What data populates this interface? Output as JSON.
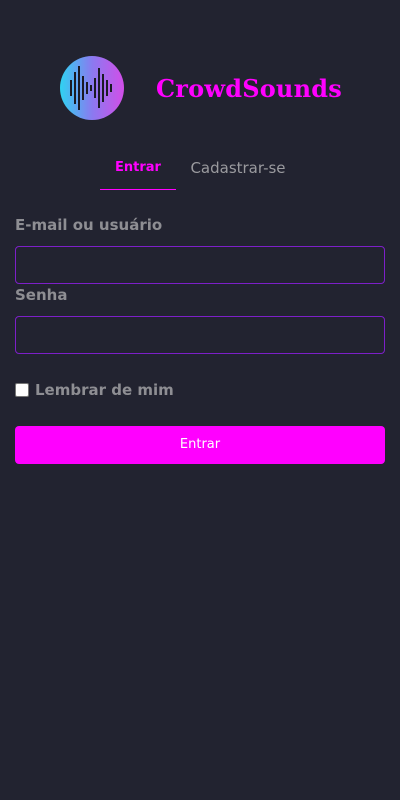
{
  "app": {
    "brand": "CrowdSounds",
    "logo_icon": "soundwave-icon"
  },
  "tabs": [
    {
      "label": "Entrar",
      "active": true
    },
    {
      "label": "Cadastrar-se",
      "active": false
    }
  ],
  "form": {
    "email_label": "E-mail ou usuário",
    "email_value": "",
    "password_label": "Senha",
    "password_value": "",
    "remember_label": "Lembrar de mim",
    "remember_checked": false,
    "submit_label": "Entrar"
  },
  "colors": {
    "background": "#222330",
    "accent": "#ff00ff",
    "input_border": "#7d1fc8",
    "label": "#8e8e93"
  }
}
